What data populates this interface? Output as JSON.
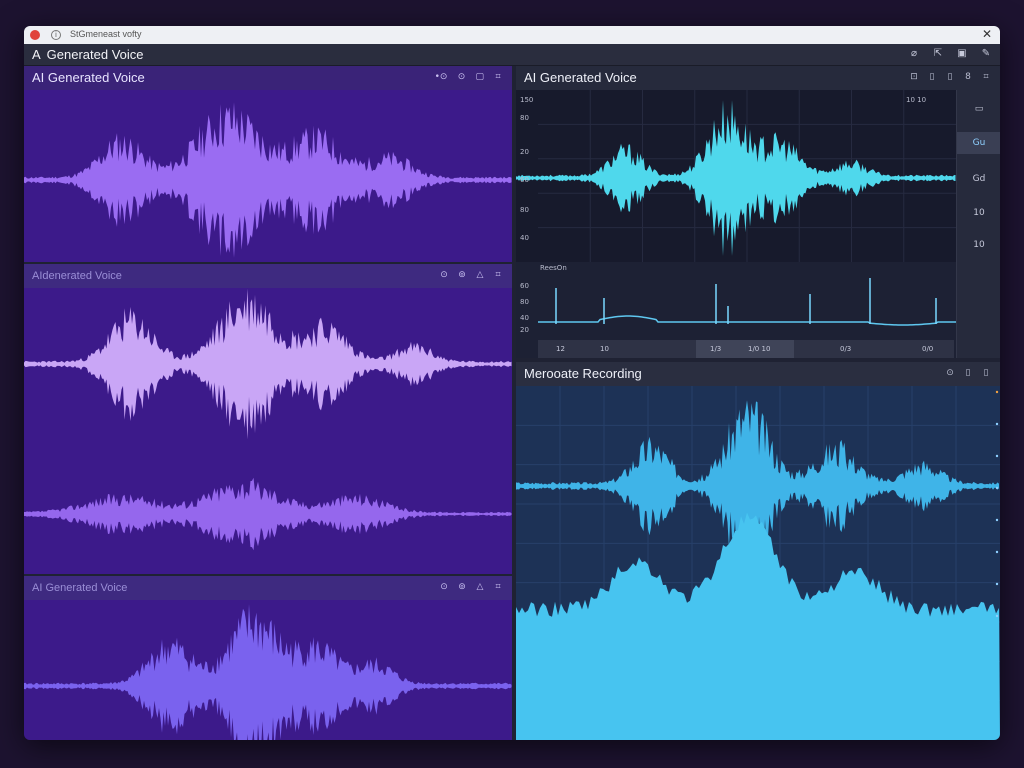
{
  "titlebar": {
    "title": "StGmeneast vofty",
    "close": "✕"
  },
  "appbar": {
    "title": "Generated Voice",
    "icons": [
      "pin-icon",
      "share-icon",
      "save-icon",
      "edit-icon"
    ],
    "glyphs": [
      "⌀",
      "⇱",
      "▣",
      "✎"
    ]
  },
  "panels": {
    "left_top": {
      "title": "AI Generated Voice",
      "icons": [
        "•⊙",
        "⊙",
        "▢",
        "⌗"
      ]
    },
    "left_mid": {
      "title": "AIdenerated Voice",
      "icons": [
        "⊙",
        "⊚",
        "△",
        "⌗"
      ]
    },
    "left_bottom": {
      "title": "AI Generated Voice",
      "icons": [
        "⊙",
        "⊚",
        "△",
        "⌗"
      ]
    },
    "right_top": {
      "title": "AI Generated Voice",
      "icons": [
        "⊡",
        "▯",
        "▯",
        "8",
        "⌗"
      ],
      "y_ticks": [
        "150",
        "80",
        "20",
        "60",
        "80",
        "40"
      ],
      "secondary_label": "ReesOn",
      "secondary_ticks": [
        "60",
        "80",
        "40",
        "20"
      ],
      "timeline": [
        "12",
        "10",
        "1/3",
        "1/0 10",
        "0/3",
        "0/0"
      ],
      "corner_text": "10 10",
      "side_tools": [
        "▭",
        "Gu",
        "Gd",
        "10",
        "10"
      ]
    },
    "right_bottom": {
      "title": "Merooate Recording",
      "icons": [
        "⊙",
        "▯",
        "▯"
      ]
    }
  },
  "colors": {
    "purple_bg": "#3c1a8a",
    "purple_wave": "#9a6cf2",
    "lilac_wave": "#c9a6f6",
    "cyan_wave": "#4fd8ec",
    "blue_wave": "#3fb4e8",
    "sky_fill": "#47c4f0"
  }
}
